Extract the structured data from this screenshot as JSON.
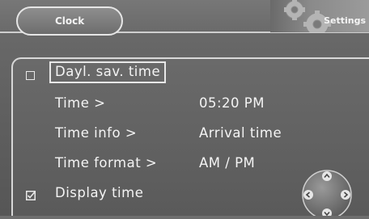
{
  "header": {
    "tab_clock": "Clock",
    "tab_settings": "Settings"
  },
  "menu": {
    "items": [
      {
        "label": "Dayl. sav. time",
        "value": "",
        "checkbox": "unchecked",
        "focused": true
      },
      {
        "label": "Time >",
        "value": "05:20 PM"
      },
      {
        "label": "Time info >",
        "value": "Arrival time"
      },
      {
        "label": "Time format >",
        "value": "AM / PM"
      },
      {
        "label": "Display time",
        "value": "",
        "checkbox": "checked"
      }
    ]
  },
  "icons": {
    "settings": "gears-icon",
    "navigation": "navigation-pad-icon"
  },
  "colors": {
    "background": "#666666",
    "text": "#f4f4f4",
    "border": "#d8d8d8"
  }
}
